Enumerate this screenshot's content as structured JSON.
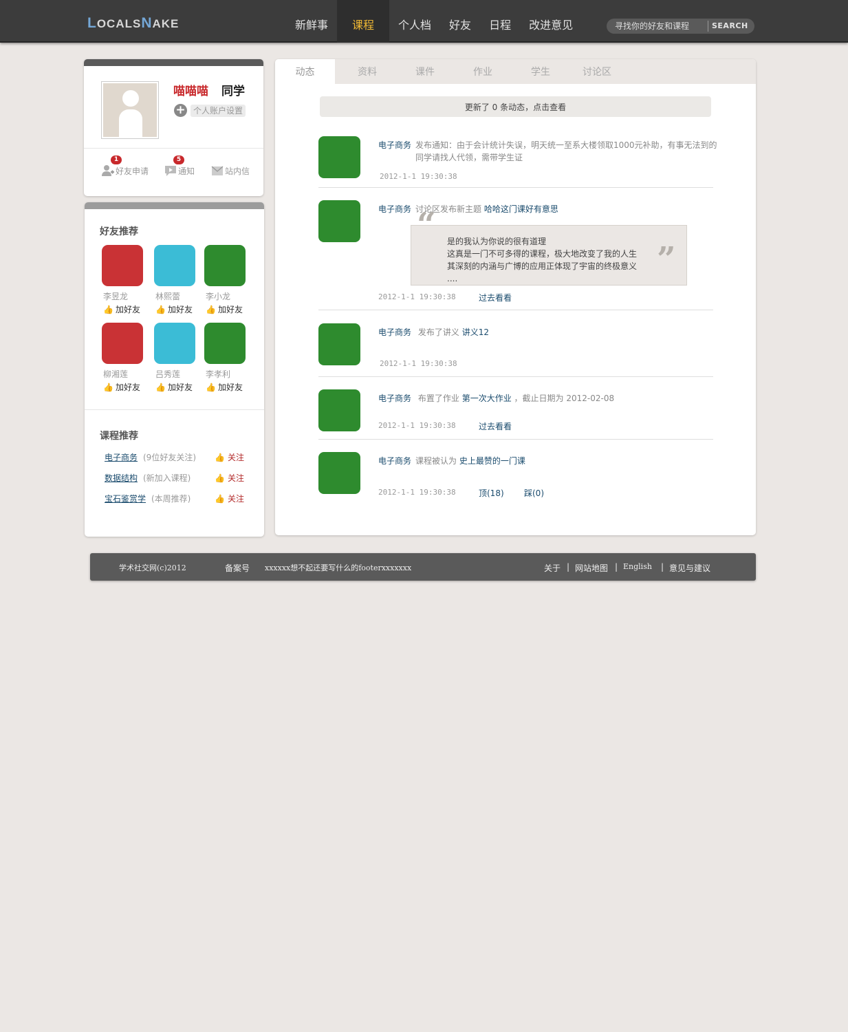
{
  "header": {
    "logo_parts": [
      "L",
      "OCALS",
      "N",
      "AKE"
    ],
    "nav": [
      "新鲜事",
      "课程",
      "个人档",
      "好友",
      "日程",
      "改进意见"
    ],
    "search_placeholder": "寻找你的好友和课程",
    "search_button": "SEARCH"
  },
  "profile": {
    "name": "喵喵喵",
    "role": "同学",
    "account_settings": "个人账户设置",
    "quick_links": [
      {
        "label": "好友申请",
        "badge": "1"
      },
      {
        "label": "通知",
        "badge": "5"
      },
      {
        "label": "站内信",
        "badge": ""
      }
    ]
  },
  "friends": {
    "title": "好友推荐",
    "add_label": "加好友",
    "items": [
      {
        "name": "李昱龙",
        "color": "#c93235"
      },
      {
        "name": "林熙蕾",
        "color": "#3bbcd6"
      },
      {
        "name": "李小龙",
        "color": "#2e8b2e"
      },
      {
        "name": "柳湘莲",
        "color": "#c93235"
      },
      {
        "name": "吕秀莲",
        "color": "#3bbcd6"
      },
      {
        "name": "李孝利",
        "color": "#2e8b2e"
      }
    ]
  },
  "courses": {
    "title": "课程推荐",
    "follow_label": "关注",
    "items": [
      {
        "name": "电子商务",
        "meta": "(9位好友关注)"
      },
      {
        "name": "数据结构",
        "meta": "(新加入课程)"
      },
      {
        "name": "宝石鉴赏学",
        "meta": "(本周推荐)"
      }
    ]
  },
  "main": {
    "tabs": [
      "动态",
      "资料",
      "课件",
      "作业",
      "学生",
      "讨论区"
    ],
    "update_notice": "更新了 0 条动态，点击查看",
    "feed": [
      {
        "source": "电子商务",
        "text": "发布通知：由于会计统计失误，明天统一至系大楼领取1000元补助，有事无法到的同学请找人代领，需带学生证",
        "time": "2012-1-1 19:30:38"
      },
      {
        "source": "电子商务",
        "text": "讨论区发布新主题",
        "link": "哈哈这门课好有意思",
        "quote": [
          "是的我认为你说的很有道理",
          "这真是一门不可多得的课程，极大地改变了我的人生",
          "其深刻的内涵与广博的应用正体现了宇宙的终极意义",
          "...."
        ],
        "time": "2012-1-1 19:30:38",
        "action": "过去看看"
      },
      {
        "source": "电子商务",
        "text": "发布了讲义",
        "link": "讲义12",
        "time": "2012-1-1 19:30:38"
      },
      {
        "source": "电子商务",
        "text": "布置了作业",
        "link": "第一次大作业",
        "after": "，截止日期为 2012-02-08",
        "time": "2012-1-1 19:30:38",
        "action": "过去看看"
      },
      {
        "source": "电子商务",
        "text": "课程被认为",
        "link": "史上最赞的一门课",
        "time": "2012-1-1 19:30:38",
        "up": "顶(18)",
        "down": "踩(0)"
      }
    ]
  },
  "footer": {
    "copyright": "学术社交网(c)2012",
    "beian": "备案号",
    "placeholder": "xxxxxx想不起还要写什么的footerxxxxxxx",
    "links": [
      "关于",
      "|",
      "网站地图",
      "|",
      "English",
      "|",
      "意见与建议"
    ]
  }
}
